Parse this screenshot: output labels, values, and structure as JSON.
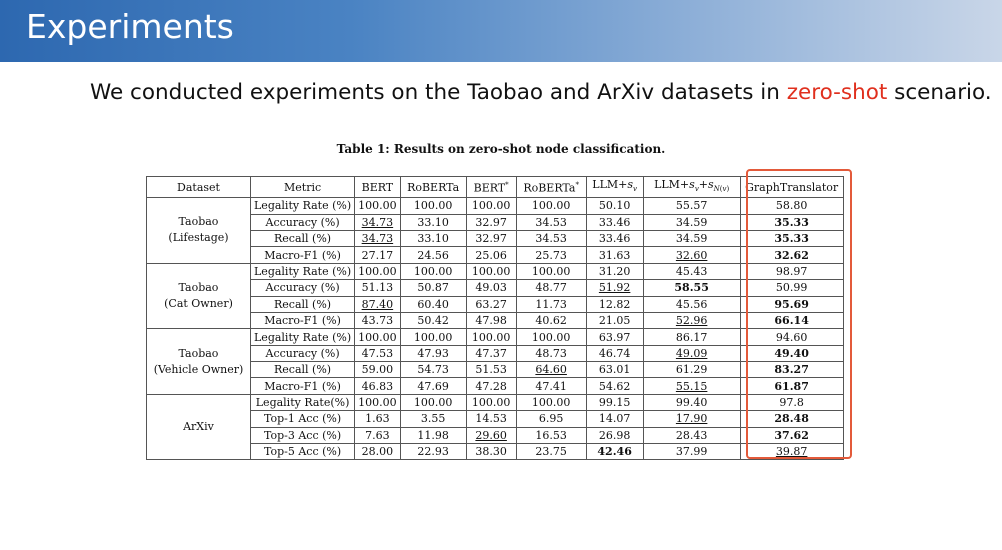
{
  "header": {
    "title": "Experiments"
  },
  "intro": {
    "before": "We conducted experiments on the Taobao and ArXiv datasets in ",
    "highlight": "zero-shot",
    "after": " scenario.",
    "highlight_color": "#e0301e"
  },
  "table": {
    "caption": "Table 1: Results on zero-shot node classification.",
    "columns": [
      "Dataset",
      "Metric",
      "BERT",
      "RoBERTa",
      "BERT*",
      "RoBERTa*",
      "LLM+s_v",
      "LLM+s_v+s_N(v)",
      "GraphTranslator"
    ],
    "groups": [
      {
        "dataset": [
          "Taobao",
          "(Lifestage)"
        ],
        "rows": [
          {
            "metric": "Legality Rate (%)",
            "values": [
              "100.00",
              "100.00",
              "100.00",
              "100.00",
              "50.10",
              "55.57",
              "58.80"
            ],
            "bold": [],
            "underline": []
          },
          {
            "metric": "Accuracy (%)",
            "values": [
              "34.73",
              "33.10",
              "32.97",
              "34.53",
              "33.46",
              "34.59",
              "35.33"
            ],
            "bold": [
              6
            ],
            "underline": [
              0
            ]
          },
          {
            "metric": "Recall (%)",
            "values": [
              "34.73",
              "33.10",
              "32.97",
              "34.53",
              "33.46",
              "34.59",
              "35.33"
            ],
            "bold": [
              6
            ],
            "underline": [
              0
            ]
          },
          {
            "metric": "Macro-F1 (%)",
            "values": [
              "27.17",
              "24.56",
              "25.06",
              "25.73",
              "31.63",
              "32.60",
              "32.62"
            ],
            "bold": [
              6
            ],
            "underline": [
              5
            ]
          }
        ]
      },
      {
        "dataset": [
          "Taobao",
          "(Cat Owner)"
        ],
        "rows": [
          {
            "metric": "Legality Rate (%)",
            "values": [
              "100.00",
              "100.00",
              "100.00",
              "100.00",
              "31.20",
              "45.43",
              "98.97"
            ],
            "bold": [],
            "underline": []
          },
          {
            "metric": "Accuracy (%)",
            "values": [
              "51.13",
              "50.87",
              "49.03",
              "48.77",
              "51.92",
              "58.55",
              "50.99"
            ],
            "bold": [
              5
            ],
            "underline": [
              4
            ]
          },
          {
            "metric": "Recall (%)",
            "values": [
              "87.40",
              "60.40",
              "63.27",
              "11.73",
              "12.82",
              "45.56",
              "95.69"
            ],
            "bold": [
              6
            ],
            "underline": [
              0
            ]
          },
          {
            "metric": "Macro-F1 (%)",
            "values": [
              "43.73",
              "50.42",
              "47.98",
              "40.62",
              "21.05",
              "52.96",
              "66.14"
            ],
            "bold": [
              6
            ],
            "underline": [
              5
            ]
          }
        ]
      },
      {
        "dataset": [
          "Taobao",
          "(Vehicle Owner)"
        ],
        "rows": [
          {
            "metric": "Legality Rate (%)",
            "values": [
              "100.00",
              "100.00",
              "100.00",
              "100.00",
              "63.97",
              "86.17",
              "94.60"
            ],
            "bold": [],
            "underline": []
          },
          {
            "metric": "Accuracy (%)",
            "values": [
              "47.53",
              "47.93",
              "47.37",
              "48.73",
              "46.74",
              "49.09",
              "49.40"
            ],
            "bold": [
              6
            ],
            "underline": [
              5
            ]
          },
          {
            "metric": "Recall (%)",
            "values": [
              "59.00",
              "54.73",
              "51.53",
              "64.60",
              "63.01",
              "61.29",
              "83.27"
            ],
            "bold": [
              6
            ],
            "underline": [
              3
            ]
          },
          {
            "metric": "Macro-F1 (%)",
            "values": [
              "46.83",
              "47.69",
              "47.28",
              "47.41",
              "54.62",
              "55.15",
              "61.87"
            ],
            "bold": [
              6
            ],
            "underline": [
              5
            ]
          }
        ]
      },
      {
        "dataset": [
          "ArXiv"
        ],
        "rows": [
          {
            "metric": "Legality Rate(%)",
            "values": [
              "100.00",
              "100.00",
              "100.00",
              "100.00",
              "99.15",
              "99.40",
              "97.8"
            ],
            "bold": [],
            "underline": []
          },
          {
            "metric": "Top-1 Acc (%)",
            "values": [
              "1.63",
              "3.55",
              "14.53",
              "6.95",
              "14.07",
              "17.90",
              "28.48"
            ],
            "bold": [
              6
            ],
            "underline": [
              5
            ]
          },
          {
            "metric": "Top-3 Acc (%)",
            "values": [
              "7.63",
              "11.98",
              "29.60",
              "16.53",
              "26.98",
              "28.43",
              "37.62"
            ],
            "bold": [
              6
            ],
            "underline": [
              2
            ]
          },
          {
            "metric": "Top-5 Acc (%)",
            "values": [
              "28.00",
              "22.93",
              "38.30",
              "23.75",
              "42.46",
              "37.99",
              "39.87"
            ],
            "bold": [
              4
            ],
            "underline": [
              6
            ]
          }
        ]
      }
    ]
  }
}
